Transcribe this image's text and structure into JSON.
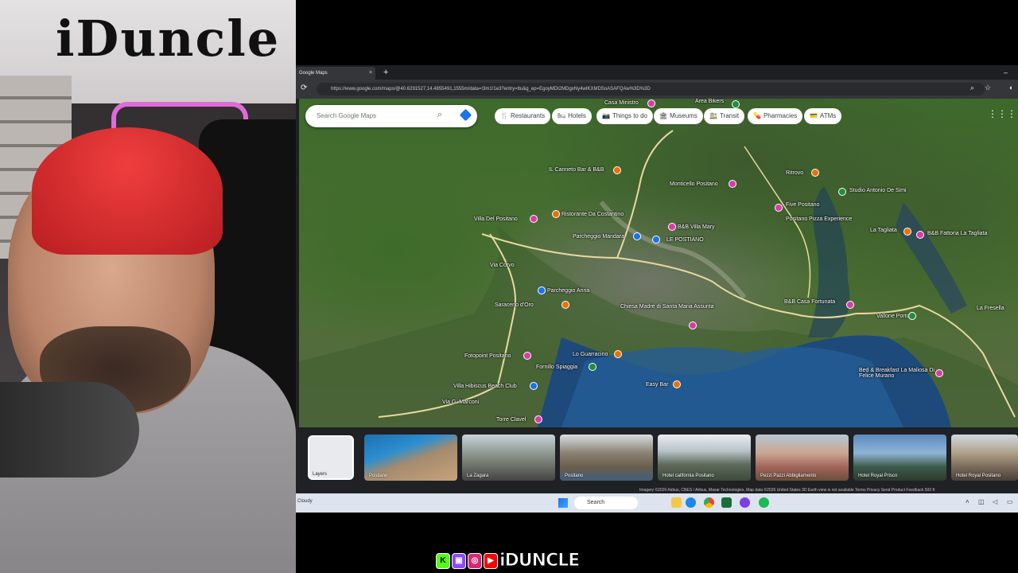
{
  "overlay": {
    "sign_text": "iDuncle",
    "brand": "iDUNCLE",
    "social_icons": [
      "kick-icon",
      "twitch-icon",
      "instagram-icon",
      "youtube-icon"
    ],
    "social_glyphs": [
      "K",
      "▣",
      "◎",
      "▶"
    ]
  },
  "browser": {
    "tab_title": "Google Maps",
    "tab_close": "×",
    "new_tab": "+",
    "url": "https://www.google.com/maps/@40.6291527,14.4855491,1555m/data=!3m1!1e3?entry=ttu&g_ep=EgoyMDI2MDgxNy4wIKXMDSoASAFQAw%3D%3D",
    "minimize": "–"
  },
  "maps": {
    "search_placeholder": "Search Google Maps",
    "chips": [
      {
        "icon": "🍴",
        "label": "Restaurants"
      },
      {
        "icon": "🛏",
        "label": "Hotels"
      },
      {
        "icon": "📷",
        "label": "Things to do"
      },
      {
        "icon": "🏛",
        "label": "Museums"
      },
      {
        "icon": "🚉",
        "label": "Transit"
      },
      {
        "icon": "💊",
        "label": "Pharmacies"
      },
      {
        "icon": "💳",
        "label": "ATMs"
      }
    ],
    "places": [
      "Casa Ministro",
      "Area Bikers",
      "IL Canneto Bar & B&B",
      "Monticello Positano",
      "Ritrovo",
      "Studio Antonio De Simi",
      "Villa Del Positano",
      "Ristorante Da Costantino",
      "Parcheggio Mandara",
      "B&B Villa Mary",
      "LE POSTIANO",
      "Five Positano",
      "Positano Pizza Experience",
      "La Tagliata",
      "B&B Fattoria La Tagliata",
      "Via Corvo",
      "Parcheggio Anna",
      "Saraceno d'Oro",
      "Chiesa Madre di Santa Maria Assunta",
      "B&B Casa Fortunata",
      "Vallone Porto",
      "La Fresella",
      "Fotopoint Positano",
      "Lo Guarracino",
      "Fornillo Spiaggia",
      "Villa Hibiscus Beach Club",
      "Easy Bar",
      "Bed & Breakfast La Maliosa Di Felice Murano",
      "Torre Clavel",
      "Via G. Marconi"
    ],
    "layers_label": "Layers",
    "thumbnails": [
      "Positano",
      "La Zagara",
      "Positano",
      "Hotel california Positano",
      "Pezzi Pazzi Abbigliamento",
      "Hotel Royal Prisco",
      "Hotel Royal Positano"
    ],
    "attribution": "Imagery ©2026 Airbus, CNES / Airbus, Maxar Technologies, Map data ©2026     United States     3D Earth view is not available     Terms     Privacy     Send Product Feedback     500 ft"
  },
  "taskbar": {
    "weather": "Cloudy",
    "search_label": "Search"
  }
}
